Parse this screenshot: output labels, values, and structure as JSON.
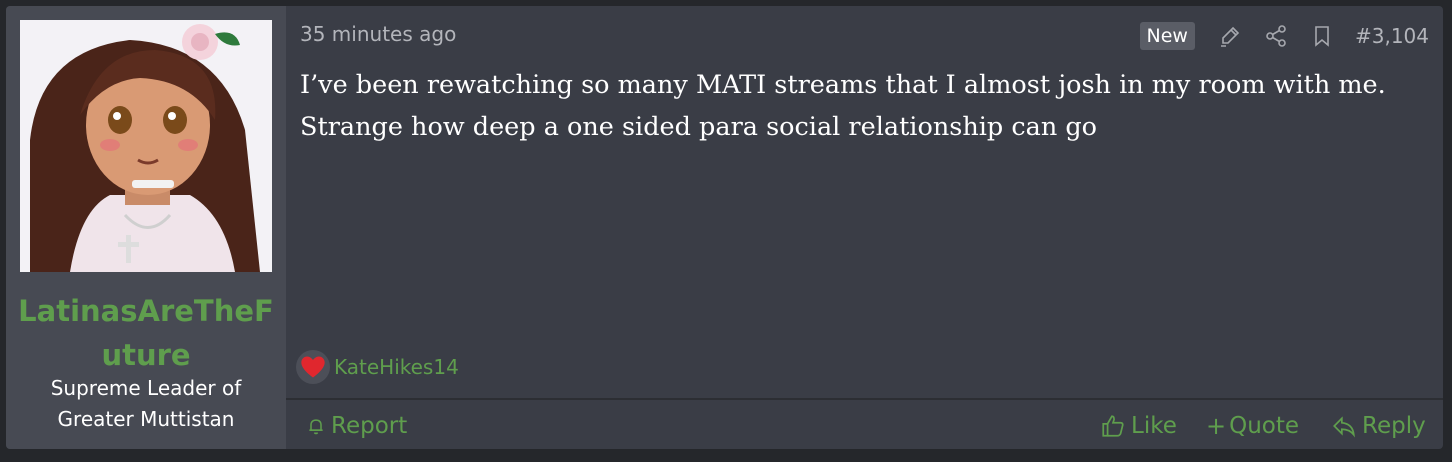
{
  "post": {
    "timestamp": "35 minutes ago",
    "new_badge": "New",
    "post_number": "#3,104",
    "body_line1": "I’ve been rewatching so many MATI streams that I almost josh in my room with me.",
    "body_line2": "Strange how deep a one sided para social relationship can go"
  },
  "user": {
    "username": "LatinasAreTheFuture",
    "title": "Supreme Leader of Greater Muttistan"
  },
  "reactions": {
    "icon": "heart-icon",
    "user": "KateHikes14"
  },
  "actions": {
    "report": "Report",
    "like": "Like",
    "quote": "Quote",
    "reply": "Reply"
  },
  "header_icons": [
    "highlighter-icon",
    "share-icon",
    "bookmark-icon"
  ],
  "colors": {
    "accent_green": "#5f9e4d",
    "post_bg": "#3a3d46",
    "user_bg": "#474a53",
    "heart": "#e0272e"
  }
}
